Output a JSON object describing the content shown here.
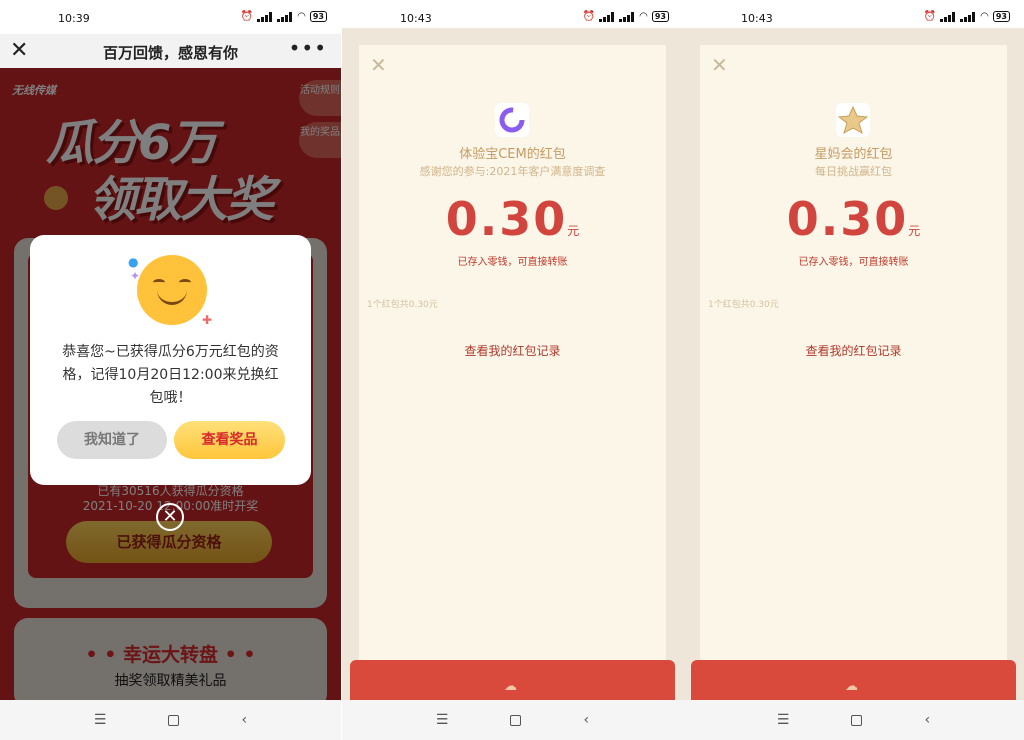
{
  "screens": [
    {
      "status": {
        "time": "10:39",
        "battery": "93"
      },
      "header": {
        "title": "百万回馈，感恩有你",
        "more": "•••"
      },
      "hero": {
        "logo": "无线传媒",
        "line1": "瓜分6万",
        "line2": "领取大奖"
      },
      "side_buttons": [
        {
          "label": "活动规则"
        },
        {
          "label": "我的奖品"
        }
      ],
      "card": {
        "count_text": "已有30516人获得瓜分资格",
        "time_text": "2021-10-20 12:00:00准时开奖",
        "status_button": "已获得瓜分资格"
      },
      "wheel": {
        "title": "• • 幸运大转盘 • •",
        "subtitle": "抽奖领取精美礼品"
      },
      "modal": {
        "message": "恭喜您~已获得瓜分6万元红包的资格，记得10月20日12:00来兑换红包哦！",
        "dismiss_button": "我知道了",
        "view_button": "查看奖品"
      }
    },
    {
      "status": {
        "time": "10:43",
        "battery": "93"
      },
      "title": "体验宝CEM的红包",
      "subtitle": "感谢您的参与:2021年客户满意度调查",
      "amount": "0.30",
      "unit": "元",
      "note": "已存入零钱，可直接转账",
      "count": "1个红包共0.30元",
      "link": "查看我的红包记录"
    },
    {
      "status": {
        "time": "10:43",
        "battery": "93"
      },
      "title": "星妈会的红包",
      "subtitle": "每日挑战赢红包",
      "amount": "0.30",
      "unit": "元",
      "note": "已存入零钱，可直接转账",
      "count": "1个红包共0.30元",
      "link": "查看我的红包记录"
    }
  ],
  "icons": {
    "close": "close-icon",
    "menu": "menu-icon",
    "home": "home-icon",
    "back": "back-icon"
  },
  "colors": {
    "accent_red": "#d2443e",
    "page_red": "#c8262a",
    "gold": "#ffc63a"
  }
}
